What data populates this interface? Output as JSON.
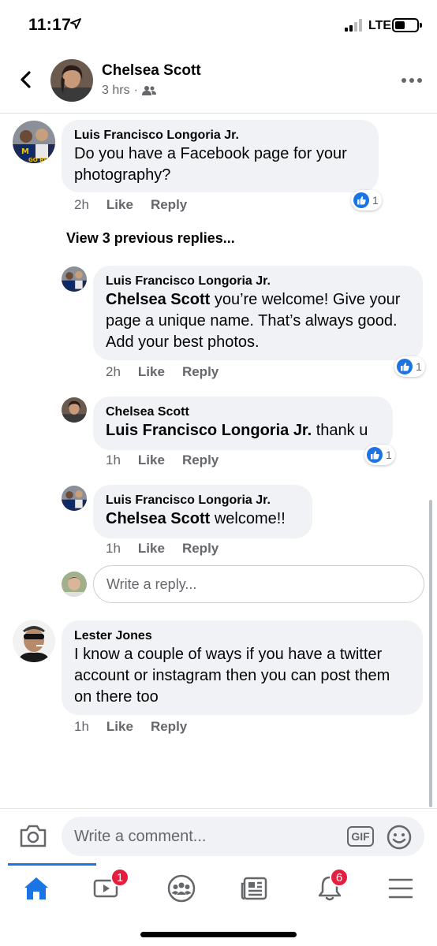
{
  "status_bar": {
    "time": "11:17",
    "network": "LTE"
  },
  "header": {
    "name": "Chelsea Scott",
    "time": "3 hrs",
    "dot": "·",
    "audience_icon": "friends-icon",
    "more_icon": "more-icon"
  },
  "comment1": {
    "author": "Luis Francisco Longoria Jr.",
    "text": "Do you have a Facebook page for your photography?",
    "time": "2h",
    "like": "Like",
    "reply": "Reply",
    "reaction_count": "1"
  },
  "view_previous": "View 3 previous replies...",
  "reply1": {
    "author": "Luis Francisco Longoria Jr.",
    "mention": "Chelsea Scott",
    "text": " you’re welcome! Give your page a unique name. That’s always good. Add your best photos.",
    "time": "2h",
    "like": "Like",
    "reply": "Reply",
    "reaction_count": "1"
  },
  "reply2": {
    "author": "Chelsea Scott",
    "mention": "Luis Francisco Longoria Jr.",
    "text": " thank u",
    "time": "1h",
    "like": "Like",
    "reply": "Reply",
    "reaction_count": "1"
  },
  "reply3": {
    "author": "Luis Francisco Longoria Jr.",
    "mention": "Chelsea Scott",
    "text": " welcome!!",
    "time": "1h",
    "like": "Like",
    "reply": "Reply"
  },
  "reply_input": {
    "placeholder": "Write a reply..."
  },
  "comment2": {
    "author": "Lester Jones",
    "text": "I know a couple of ways if you have a twitter account or instagram then you can post them on there too",
    "time": "1h",
    "like": "Like",
    "reply": "Reply"
  },
  "composer": {
    "placeholder": "Write a comment...",
    "gif": "GIF"
  },
  "tabbar": {
    "tabs": [
      {
        "icon": "home-icon",
        "active": true
      },
      {
        "icon": "watch-icon",
        "badge": "1"
      },
      {
        "icon": "groups-icon"
      },
      {
        "icon": "news-icon"
      },
      {
        "icon": "bell-icon",
        "badge": "6"
      },
      {
        "icon": "menu-icon"
      }
    ]
  },
  "colors": {
    "accent": "#1b74e4",
    "bubble": "#f0f2f5",
    "secondary_text": "#65676b",
    "badge": "#e41e3f"
  }
}
